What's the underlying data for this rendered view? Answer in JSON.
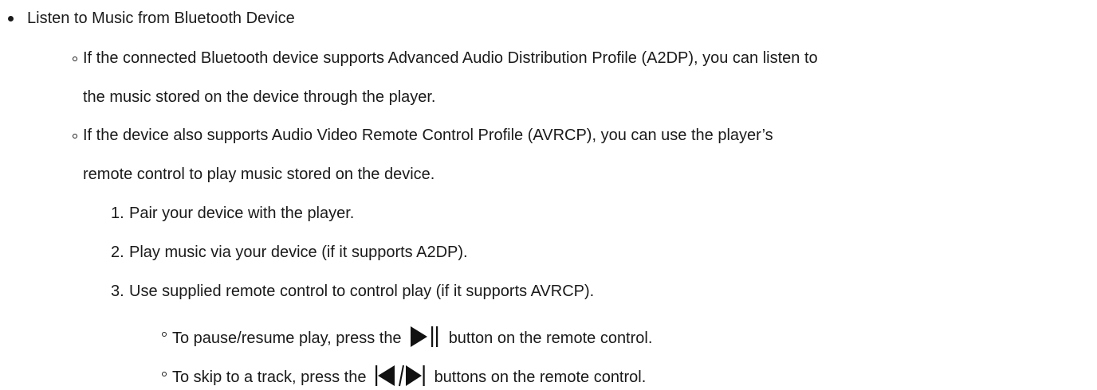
{
  "section": {
    "heading": "Listen to Music from Bluetooth Device",
    "items": [
      {
        "line1": "If the connected Bluetooth device supports Advanced Audio Distribution Profile (A2DP), you can listen to",
        "line2": "the music stored on the device through the player."
      },
      {
        "line1": "If the device also supports Audio Video Remote Control Profile (AVRCP), you can use the player’s",
        "line2": "remote control to play music stored on the device."
      }
    ],
    "steps": [
      {
        "number": "1.",
        "text": "Pair your device with the player."
      },
      {
        "number": "2.",
        "text": "Play music via your device (if it supports A2DP)."
      },
      {
        "number": "3.",
        "text": "Use supplied remote control to control play (if it supports AVRCP)."
      }
    ],
    "sub_items": [
      {
        "before": "To pause/resume play, press the",
        "icon": "play-pause-icon",
        "after": "button on the remote control."
      },
      {
        "before": "To skip to a track, press the",
        "icon": "skip-track-icon",
        "after": "buttons on the remote control."
      }
    ]
  }
}
